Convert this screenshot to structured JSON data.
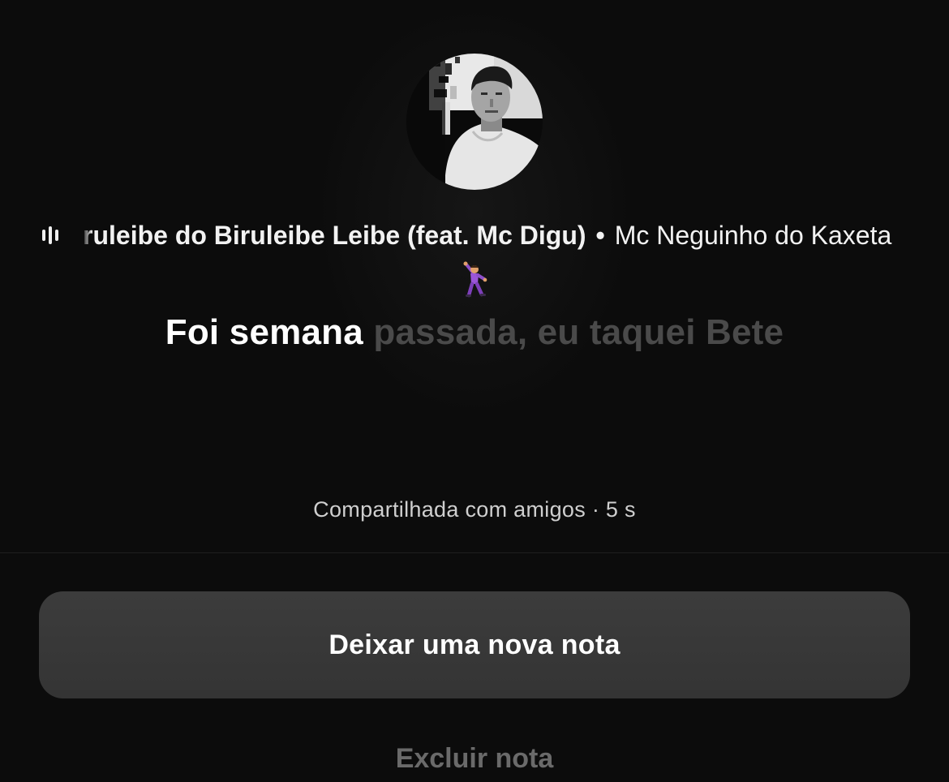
{
  "note": {
    "music": {
      "icon": "audio-waveform-icon",
      "track_title": "Biruleibe do Biruleibe Leibe (feat. Mc Digu)",
      "separator": "•",
      "artist": "Mc Neguinho do Kaxeta"
    },
    "emoji": "dancing-man-emoji",
    "lyric_active": "Foi semana",
    "lyric_inactive": "passada, eu taquei Bete",
    "shared_info": "Compartilhada com amigos · 5 s"
  },
  "actions": {
    "new_note_label": "Deixar uma nova nota",
    "delete_note_label": "Excluir nota"
  },
  "colors": {
    "background": "#0c0c0c",
    "button_background": "#3a3a3a",
    "lyric_active": "#ffffff",
    "lyric_inactive": "#4a4a4a",
    "delete_text": "#6a6a6a"
  }
}
